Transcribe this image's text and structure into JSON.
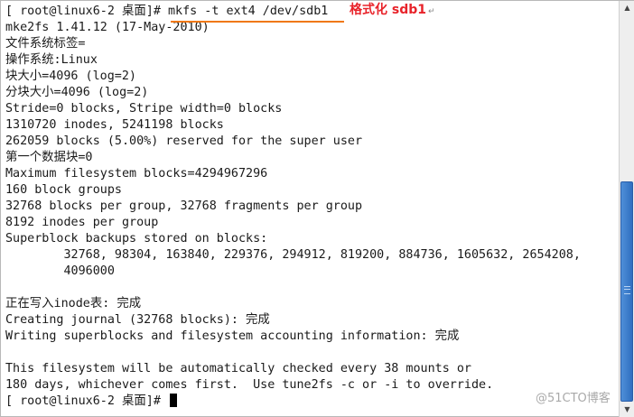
{
  "terminal": {
    "lines": [
      "[ root@linux6-2 桌面]# mkfs -t ext4 /dev/sdb1",
      "mke2fs 1.41.12 (17-May-2010)",
      "文件系统标签=",
      "操作系统:Linux",
      "块大小=4096 (log=2)",
      "分块大小=4096 (log=2)",
      "Stride=0 blocks, Stripe width=0 blocks",
      "1310720 inodes, 5241198 blocks",
      "262059 blocks (5.00%) reserved for the super user",
      "第一个数据块=0",
      "Maximum filesystem blocks=4294967296",
      "160 block groups",
      "32768 blocks per group, 32768 fragments per group",
      "8192 inodes per group",
      "Superblock backups stored on blocks:",
      "        32768, 98304, 163840, 229376, 294912, 819200, 884736, 1605632, 2654208,",
      "        4096000",
      "",
      "正在写入inode表: 完成",
      "Creating journal (32768 blocks): 完成",
      "Writing superblocks and filesystem accounting information: 完成",
      "",
      "This filesystem will be automatically checked every 38 mounts or",
      "180 days, whichever comes first.  Use tune2fs -c or -i to override.",
      "[ root@linux6-2 桌面]# "
    ]
  },
  "annotation": {
    "label": "格式化 sdb1",
    "mark": "↵",
    "color": "#e8232a",
    "underline_color": "#f07814"
  },
  "watermark": "@51CTO博客",
  "scrollbar": {
    "up_icon": "▲",
    "down_icon": "▼",
    "thumb_color": "#3a7bd0"
  }
}
